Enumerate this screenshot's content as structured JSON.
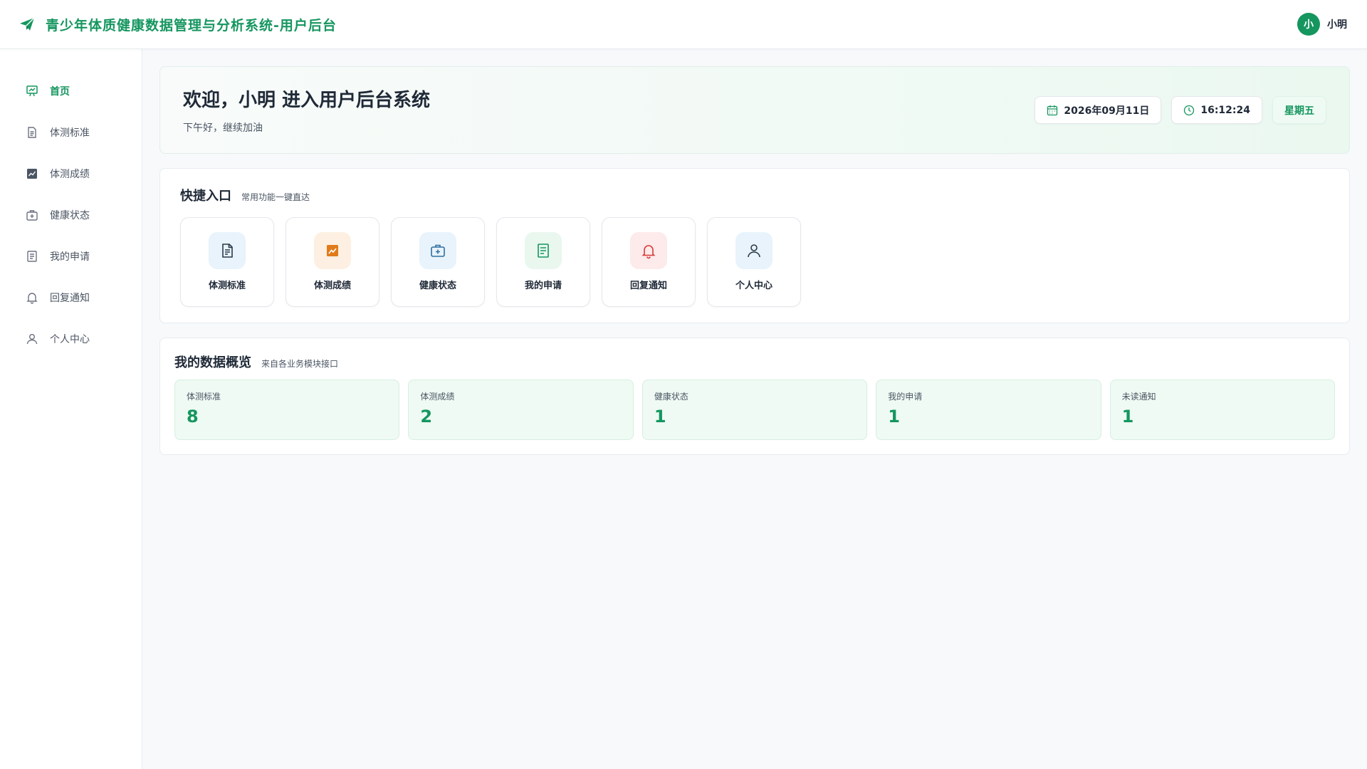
{
  "header": {
    "title": "青少年体质健康数据管理与分析系统-用户后台",
    "icon": "paper-plane-icon",
    "user": {
      "avatar_text": "小",
      "name": "小明"
    }
  },
  "sidebar": {
    "items": [
      {
        "label": "首页",
        "icon": "home-icon",
        "active": true
      },
      {
        "label": "体测标准",
        "icon": "document-icon"
      },
      {
        "label": "体测成绩",
        "icon": "chart-icon"
      },
      {
        "label": "健康状态",
        "icon": "medical-kit-icon"
      },
      {
        "label": "我的申请",
        "icon": "form-icon"
      },
      {
        "label": "回复通知",
        "icon": "bell-icon"
      },
      {
        "label": "个人中心",
        "icon": "user-icon"
      }
    ]
  },
  "welcome": {
    "title": "欢迎，小明 进入用户后台系统",
    "subtitle": "下午好，继续加油",
    "date": "2026年09月11日",
    "time": "16:12:24",
    "weekday": "星期五"
  },
  "quick": {
    "title": "快捷入口",
    "subtitle": "常用功能一键直达",
    "tiles": [
      {
        "label": "体测标准",
        "icon": "document-icon",
        "bg": "#e8f3fb",
        "color": "#2b3a4a"
      },
      {
        "label": "体测成绩",
        "icon": "chart-icon",
        "bg": "#fdf0e2",
        "color": "#e07b1a"
      },
      {
        "label": "健康状态",
        "icon": "medical-kit-icon",
        "bg": "#e8f3fb",
        "color": "#2f6f9f"
      },
      {
        "label": "我的申请",
        "icon": "form-icon",
        "bg": "#e9f7ef",
        "color": "#15965f"
      },
      {
        "label": "回复通知",
        "icon": "bell-icon",
        "bg": "#fdeaea",
        "color": "#d93a3a"
      },
      {
        "label": "个人中心",
        "icon": "user-icon",
        "bg": "#e8f3fb",
        "color": "#2b3a4a"
      }
    ]
  },
  "overview": {
    "title": "我的数据概览",
    "subtitle": "来自各业务模块接口",
    "stats": [
      {
        "label": "体测标准",
        "value": "8"
      },
      {
        "label": "体测成绩",
        "value": "2"
      },
      {
        "label": "健康状态",
        "value": "1"
      },
      {
        "label": "我的申请",
        "value": "1"
      },
      {
        "label": "未读通知",
        "value": "1"
      }
    ]
  },
  "colors": {
    "primary": "#15965f",
    "stat_bg": "#eefaf3"
  }
}
